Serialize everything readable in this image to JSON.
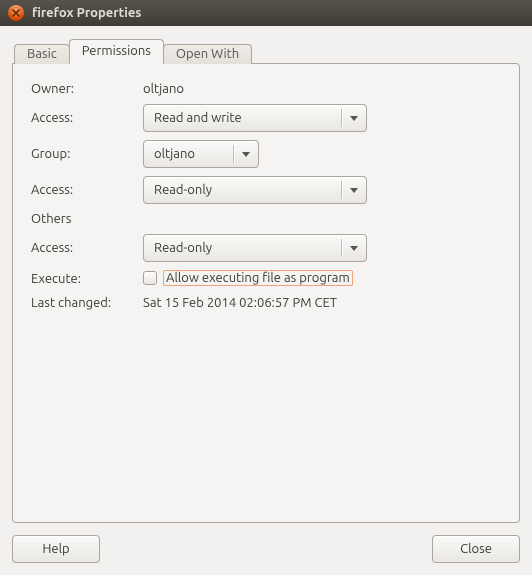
{
  "window": {
    "title": "firefox Properties"
  },
  "tabs": {
    "basic": "Basic",
    "permissions": "Permissions",
    "open_with": "Open With"
  },
  "form": {
    "owner_label": "Owner:",
    "owner_value": "oltjano",
    "owner_access_label": "Access:",
    "owner_access_value": "Read and write",
    "group_label": "Group:",
    "group_value": "oltjano",
    "group_access_label": "Access:",
    "group_access_value": "Read-only",
    "others_label": "Others",
    "others_access_label": "Access:",
    "others_access_value": "Read-only",
    "execute_label": "Execute:",
    "execute_chk_label": "Allow executing file as program",
    "last_changed_label": "Last changed:",
    "last_changed_value": "Sat 15 Feb 2014 02:06:57 PM CET"
  },
  "buttons": {
    "help": "Help",
    "close": "Close"
  }
}
